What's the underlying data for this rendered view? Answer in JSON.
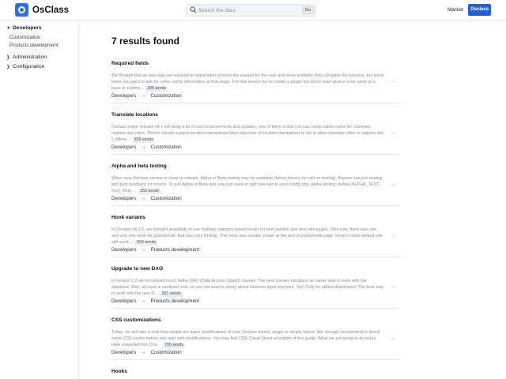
{
  "header": {
    "logo_text": "OsClass",
    "search_placeholder": "Search the docs",
    "go_label": "Go",
    "market_label": "Market",
    "account_label": "Osclass"
  },
  "sidebar": {
    "sections": [
      {
        "label": "Developers",
        "open": true,
        "items": [
          {
            "label": "Customization"
          },
          {
            "label": "Products development"
          }
        ]
      },
      {
        "label": "Administration",
        "open": false,
        "items": []
      },
      {
        "label": "Configuration",
        "open": false,
        "items": []
      }
    ]
  },
  "main": {
    "results_title": "7 results found",
    "results": [
      {
        "title": "Required fields",
        "excerpt": "We thought that as less data we required at registration process the easiest for the user and more probably they complete the process, but some times you want to ask for some useful information at that stage. For that reason we've create a plugin but which main goal is to be used as a base or examp...",
        "words": "285 words",
        "crumbs": [
          "Developers",
          "Customization"
        ]
      },
      {
        "title": "Translate locations",
        "excerpt": "Osclass major release v4.1 will bring a lot of cool improvements and updates, one of them is that you can setup native name for countries, regions and cities. Theme should support location translations Main objective of location translations is not to allow translate cities or regions into 5 differe...",
        "words": "829 words",
        "crumbs": [
          "Developers",
          "Customization"
        ]
      },
      {
        "title": "Alpha and beta testing",
        "excerpt": "When new Osclass version is close to release, Alpha or Beta testing may be available (follow forums for call on testing). Anyone can join testing and post feedback on forums. To join Alpha or Beta test, you just need to add new row to your config.php. Alpha testing: define('ALPHA_TEST', true); Beta ...",
        "words": "153 words",
        "crumbs": [
          "Developers",
          "Customization"
        ]
      },
      {
        "title": "Hook variants",
        "excerpt": "In Osclass v8.2.0, we brought possibility to use multiple category-based hooks for item publish and item edit pages. Until now, there was one and only one hook for publish/edit, that was very limiting. This hook was usually shown at the end of publish/edit page. Keep in mind default one still need ...",
        "words": "694 words",
        "crumbs": [
          "Developers",
          "Products development"
        ]
      },
      {
        "title": "Upgrade to new DAO",
        "excerpt": "In version 2.3 we introduced much better DAO (Data Access Object) classes. The new classes introduce an easier way to work with the database. Also, all input is sanitized now, so you not need to worry about insecure input anymore. Yay! Only for skilled developers! The best way to work with the new D...",
        "words": "381 words",
        "crumbs": [
          "Developers",
          "Products development"
        ]
      },
      {
        "title": "CSS customizations",
        "excerpt": "Today, we will take a look how simple are basic modifications of your Osclass theme, plugin or simply layout. We strongly recommend to check some CSS basics before you start with modifications. You may find CSS Cheat Sheet at bottom of this guide. What we are going to do today: Hide unwanted box Cha...",
        "words": "795 words",
        "crumbs": [
          "Developers",
          "Customization"
        ]
      },
      {
        "title": "Hooks",
        "excerpt": "",
        "words": "",
        "crumbs": []
      }
    ]
  },
  "icons": {
    "search": "search-icon",
    "chevron_open": "chevron-down-icon",
    "chevron_closed": "chevron-right-icon",
    "result_arrow": "arrow-right-icon",
    "breadcrumb_arrow": "arrow-right-icon"
  },
  "colors": {
    "accent": "#1f5fe0",
    "logo": "#2f6fdf"
  }
}
